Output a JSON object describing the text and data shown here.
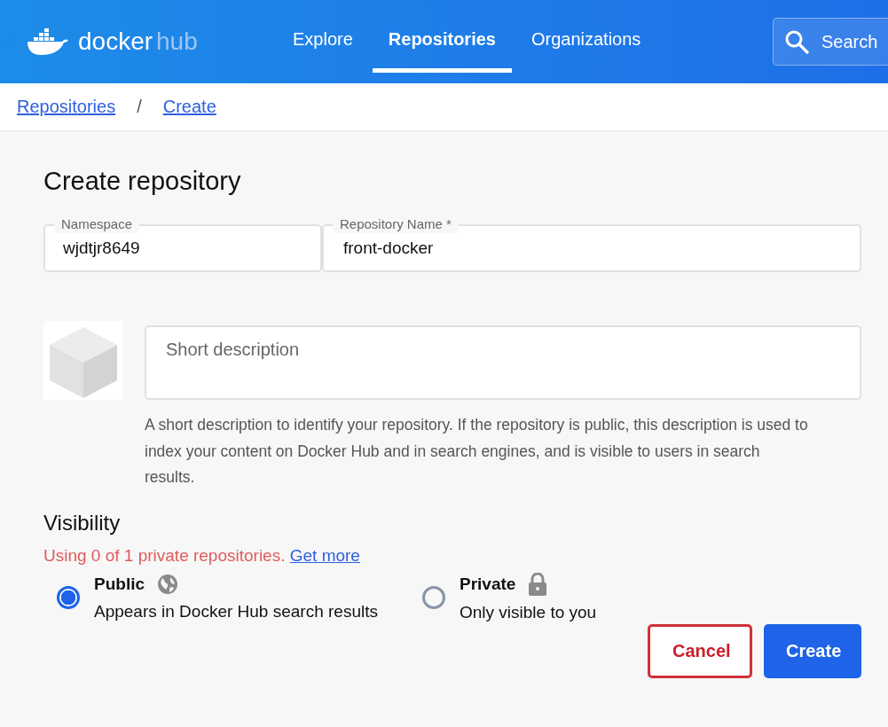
{
  "header": {
    "logo": {
      "primary": "docker",
      "secondary": "hub"
    },
    "nav": [
      {
        "label": "Explore",
        "selected": false
      },
      {
        "label": "Repositories",
        "selected": true
      },
      {
        "label": "Organizations",
        "selected": false
      }
    ],
    "search": {
      "placeholder": "Search"
    }
  },
  "breadcrumb": [
    "Repositories",
    "Create"
  ],
  "breadcrumb_separator": "/",
  "form": {
    "title": "Create repository",
    "namespace": {
      "label": "Namespace",
      "value": "wjdtjr8649"
    },
    "repository_name": {
      "label": "Repository Name *",
      "value": "front-docker"
    },
    "description": {
      "placeholder": "Short description",
      "help": "A short description to identify your repository. If the repository is public, this description is used to index your content on Docker Hub and in search engines, and is visible to users in search results."
    },
    "visibility": {
      "title": "Visibility",
      "usage": "Using 0 of 1 private repositories.",
      "usage_link": "Get more",
      "options": [
        {
          "label": "Public",
          "description": "Appears in Docker Hub search results",
          "kind": "globe",
          "selected": true
        },
        {
          "label": "Private",
          "description": "Only visible to you",
          "kind": "lock",
          "selected": false
        }
      ]
    },
    "buttons": [
      {
        "label": "Cancel",
        "kind": "secondary"
      },
      {
        "label": "Create",
        "kind": "primary"
      }
    ]
  }
}
